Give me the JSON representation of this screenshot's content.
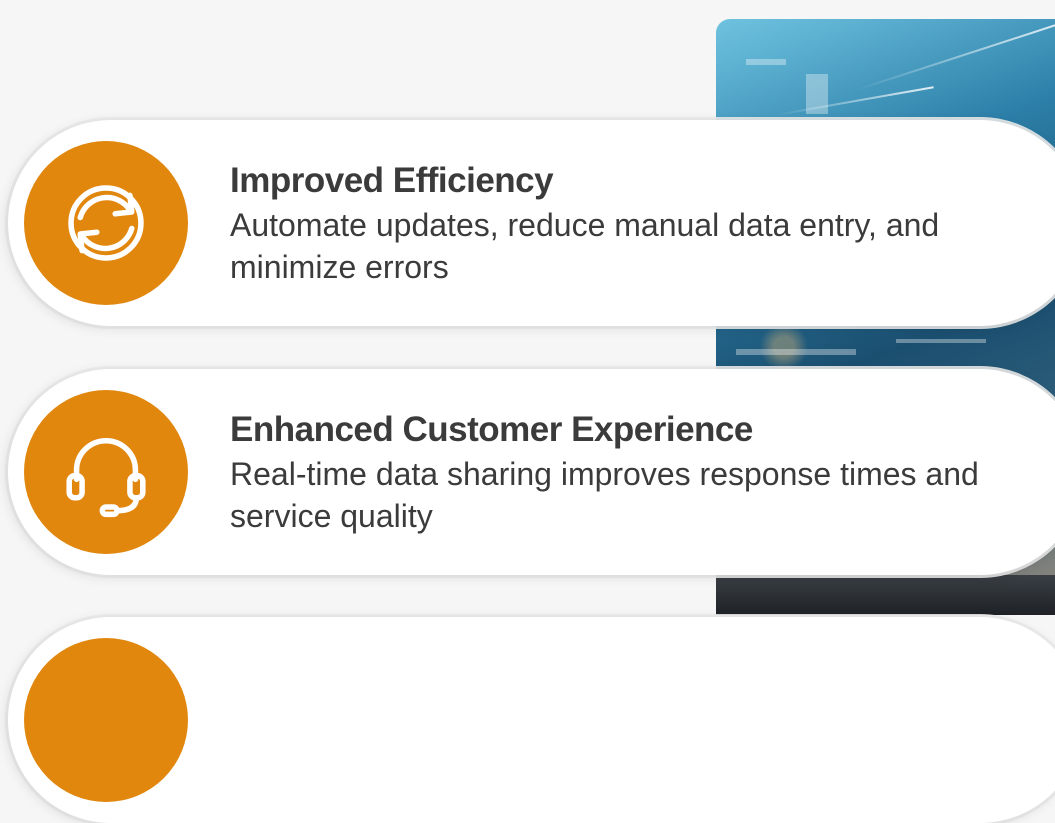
{
  "cards": [
    {
      "title": "Improved Efficiency",
      "description": "Automate updates, reduce manual data entry, and minimize errors",
      "icon": "refresh-icon"
    },
    {
      "title": "Enhanced Customer Experience",
      "description": "Real-time data sharing improves response times and service quality",
      "icon": "headset-icon"
    },
    {
      "title": "",
      "description": "",
      "icon": ""
    }
  ],
  "colors": {
    "accent": "#e1870e",
    "text": "#3b3b3b",
    "card": "#ffffff",
    "background": "#f6f6f6"
  }
}
